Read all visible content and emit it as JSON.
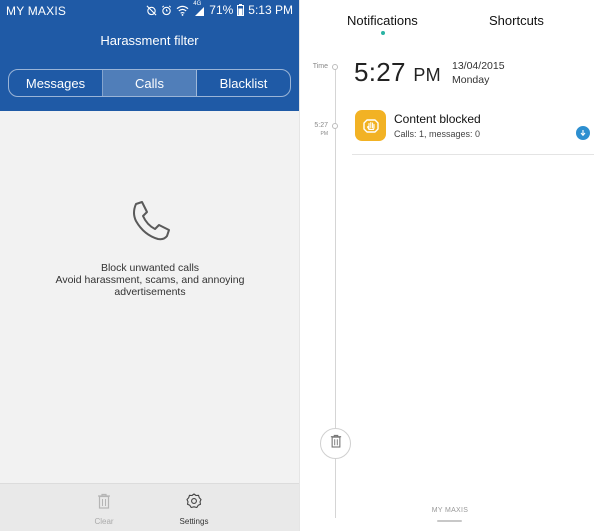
{
  "left": {
    "status_bar": {
      "carrier": "MY MAXIS",
      "network": "4G",
      "battery": "71%",
      "time": "5:13 PM"
    },
    "title": "Harassment filter",
    "tabs": [
      {
        "label": "Messages",
        "active": false
      },
      {
        "label": "Calls",
        "active": true
      },
      {
        "label": "Blacklist",
        "active": false
      }
    ],
    "empty_state": {
      "icon": "phone-icon",
      "line1": "Block unwanted calls",
      "line2": "Avoid harassment, scams, and annoying advertisements"
    },
    "bottom_bar": {
      "clear_label": "Clear",
      "settings_label": "Settings"
    },
    "colors": {
      "header": "#1f5aa6",
      "body": "#f2f2f2"
    }
  },
  "right": {
    "tabs": {
      "notifications": "Notifications",
      "shortcuts": "Shortcuts"
    },
    "timeline": {
      "label_time": "Time",
      "label_527": "5:27",
      "label_pm": "PM"
    },
    "clock": {
      "time": "5:27",
      "ampm": "PM",
      "date": "13/04/2015",
      "day": "Monday"
    },
    "notification": {
      "title": "Content blocked",
      "subtitle": "Calls: 1, messages: 0",
      "icon": "hand-stop-icon"
    },
    "footer_carrier": "MY MAXIS",
    "colors": {
      "notif_icon": "#f2b224",
      "badge": "#2d8fd0",
      "tab_indicator": "#2ab3a3"
    }
  }
}
